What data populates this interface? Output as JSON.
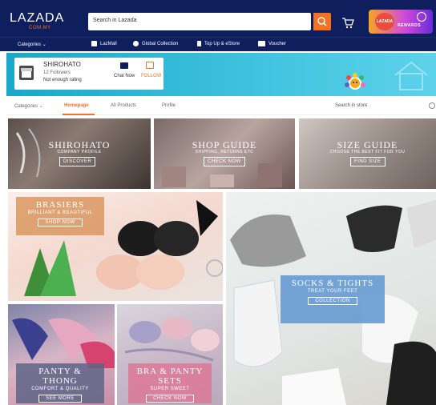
{
  "header": {
    "logo": "LAZADA",
    "logo_sub": "COM.MY",
    "search_placeholder": "Search in Lazada",
    "promo_badge": "LAZADA WALLET",
    "promo_rewards": "REWARDS"
  },
  "nav": {
    "categories": "Categories",
    "items": [
      {
        "label": "LazMall",
        "icon": "lazmall-icon"
      },
      {
        "label": "Global Collection",
        "icon": "globe-icon"
      },
      {
        "label": "Top Up & eStore",
        "icon": "phone-icon"
      },
      {
        "label": "Voucher",
        "icon": "voucher-icon"
      }
    ]
  },
  "store": {
    "name": "SHIROHATO",
    "followers": "12 Followers",
    "rating": "Not enough rating",
    "chat_label": "Chat Now",
    "follow_label": "FOLLOW"
  },
  "tabs": {
    "items": [
      "Categories",
      "Homepage",
      "All Products",
      "Profile"
    ],
    "active": "Homepage",
    "store_search_placeholder": "Search in store"
  },
  "guides": [
    {
      "title": "SHIROHATO",
      "subtitle": "COMPANY PROFILE",
      "button": "DISCOVER"
    },
    {
      "title": "SHOP GUIDE",
      "subtitle": "SHIPPING, RETURNS ETC",
      "button": "CHECK NOW"
    },
    {
      "title": "SIZE GUIDE",
      "subtitle": "CHOOSE THE BEST FIT FOR YOU",
      "button": "FIND SIZE"
    }
  ],
  "tiles": {
    "bras": {
      "title": "BRASIERS",
      "subtitle": "BRILLIANT & BEAUTIFUL",
      "button": "SHOP NOW"
    },
    "socks": {
      "title": "SOCKS & TIGHTS",
      "subtitle": "TREAT YOUR FEET",
      "button": "COLLECTION"
    },
    "panty": {
      "title": "PANTY & THONG",
      "subtitle": "COMFORT & QUALITY",
      "button": "SEE MORE"
    },
    "braset": {
      "title": "BRA & PANTY SETS",
      "subtitle": "SUPER SWEET",
      "button": "CHECK NOW"
    }
  },
  "colors": {
    "header_bg": "#0f1e5c",
    "accent": "#f57224",
    "store_banner": "#40c4df"
  }
}
